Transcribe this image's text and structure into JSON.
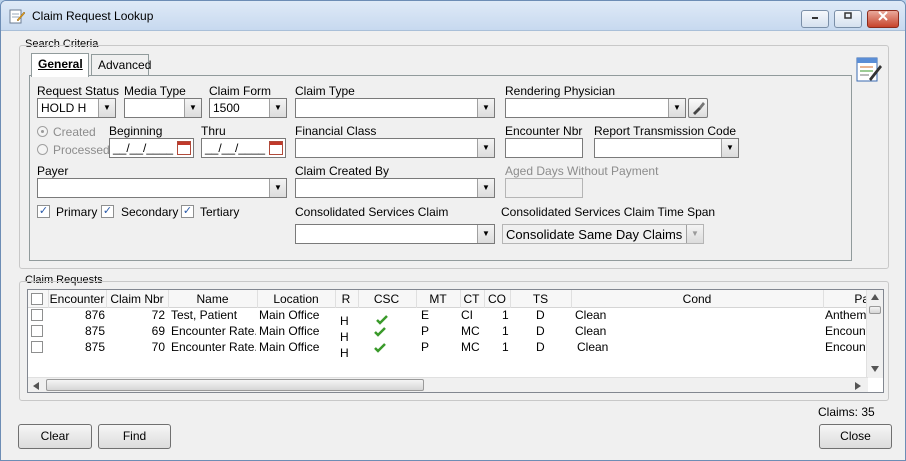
{
  "window": {
    "title": "Claim Request Lookup"
  },
  "search": {
    "group_label": "Search Criteria",
    "tabs": [
      {
        "label": "General"
      },
      {
        "label": "Advanced"
      }
    ],
    "request_status": {
      "label": "Request Status",
      "value": "HOLD  H"
    },
    "media_type": {
      "label": "Media Type",
      "value": ""
    },
    "claim_form": {
      "label": "Claim Form",
      "value": "1500"
    },
    "claim_type": {
      "label": "Claim Type",
      "value": ""
    },
    "rendering_physician": {
      "label": "Rendering Physician",
      "value": ""
    },
    "created_radio": "Created",
    "processed_radio": "Processed",
    "beginning": {
      "label": "Beginning",
      "value": "__/__/____"
    },
    "thru": {
      "label": "Thru",
      "value": "__/__/____"
    },
    "financial_class": {
      "label": "Financial Class",
      "value": ""
    },
    "encounter_nbr": {
      "label": "Encounter Nbr",
      "value": ""
    },
    "report_transmission_code": {
      "label": "Report Transmission Code",
      "value": ""
    },
    "payer": {
      "label": "Payer",
      "value": ""
    },
    "claim_created_by": {
      "label": "Claim Created By",
      "value": ""
    },
    "aged_days": {
      "label": "Aged Days Without Payment",
      "value": ""
    },
    "primary": "Primary",
    "secondary": "Secondary",
    "tertiary": "Tertiary",
    "consolidated_services_claim": {
      "label": "Consolidated Services Claim",
      "value": ""
    },
    "consolidated_time_span": {
      "label": "Consolidated Services Claim Time Span",
      "value": "Consolidate Same Day Claims"
    }
  },
  "claims": {
    "group_label": "Claim Requests",
    "columns": [
      "Encounter",
      "Claim Nbr",
      "Name",
      "Location",
      "R",
      "CSC",
      "MT",
      "CT",
      "CO",
      "TS",
      "Cond",
      "Pa"
    ],
    "rows": [
      {
        "encounter": "876",
        "claim_nbr": "72",
        "name": "Test, Patient",
        "location": "Main Office",
        "r": "H",
        "mt": "E",
        "ct": "CI",
        "co": "1",
        "ts": "D",
        "cond": "Clean",
        "payer": "Anthem I"
      },
      {
        "encounter": "875",
        "claim_nbr": "69",
        "name": "Encounter Rate...",
        "location": "Main Office",
        "r": "H",
        "mt": "P",
        "ct": "MC",
        "co": "1",
        "ts": "D",
        "cond": "Clean",
        "payer": "Encounte"
      },
      {
        "encounter": "875",
        "claim_nbr": "70",
        "name": "Encounter Rate...",
        "location": "Main Office",
        "r": "H",
        "mt": "P",
        "ct": "MC",
        "co": "1",
        "ts": "D",
        "cond": "Clean",
        "payer": "Encounte"
      }
    ],
    "count_label": "Claims: 35"
  },
  "buttons": {
    "clear": "Clear",
    "find": "Find",
    "close": "Close"
  },
  "colors": {
    "check": "#3a9a2a",
    "title_bar": "#c7d9ef"
  }
}
